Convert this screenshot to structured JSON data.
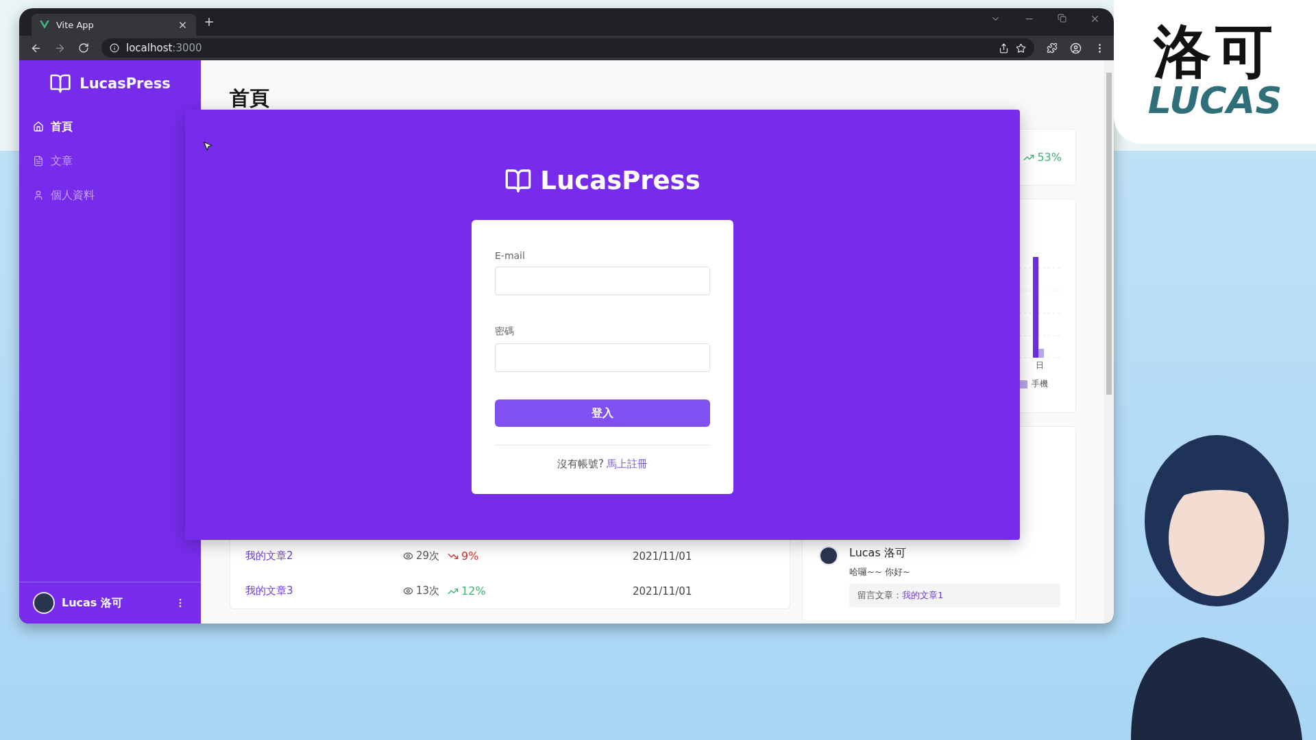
{
  "browser": {
    "tab_title": "Vite App",
    "url_host": "localhost",
    "url_port": ":3000"
  },
  "sidebar": {
    "brand": "LucasPress",
    "items": [
      {
        "label": "首頁",
        "selected": true
      },
      {
        "label": "文章",
        "selected": false
      },
      {
        "label": "個人資料",
        "selected": false
      }
    ],
    "user": {
      "name": "Lucas 洛可"
    }
  },
  "page": {
    "title": "首頁"
  },
  "stat_card": {
    "rising": true,
    "change": "53%"
  },
  "chart_card": {
    "x_label": "日",
    "legend": "手機"
  },
  "articles": [
    {
      "title": "我的文章2",
      "views": "29次",
      "rising": false,
      "change": "9%",
      "date": "2021/11/01"
    },
    {
      "title": "我的文章3",
      "views": "13次",
      "rising": true,
      "change": "12%",
      "date": "2021/11/01"
    }
  ],
  "comment": {
    "author": "Lucas 洛可",
    "text": "哈囉~~ 你好~",
    "ref_label": "留言文章：",
    "ref_link": "我的文章1"
  },
  "login_modal": {
    "brand": "LucasPress",
    "email_label": "E-mail",
    "password_label": "密碼",
    "submit": "登入",
    "signup_prompt": "沒有帳號?",
    "signup_link": "馬上註冊"
  },
  "overlay": {
    "logo_top": "洛可",
    "logo_bottom": "LUCAS"
  }
}
